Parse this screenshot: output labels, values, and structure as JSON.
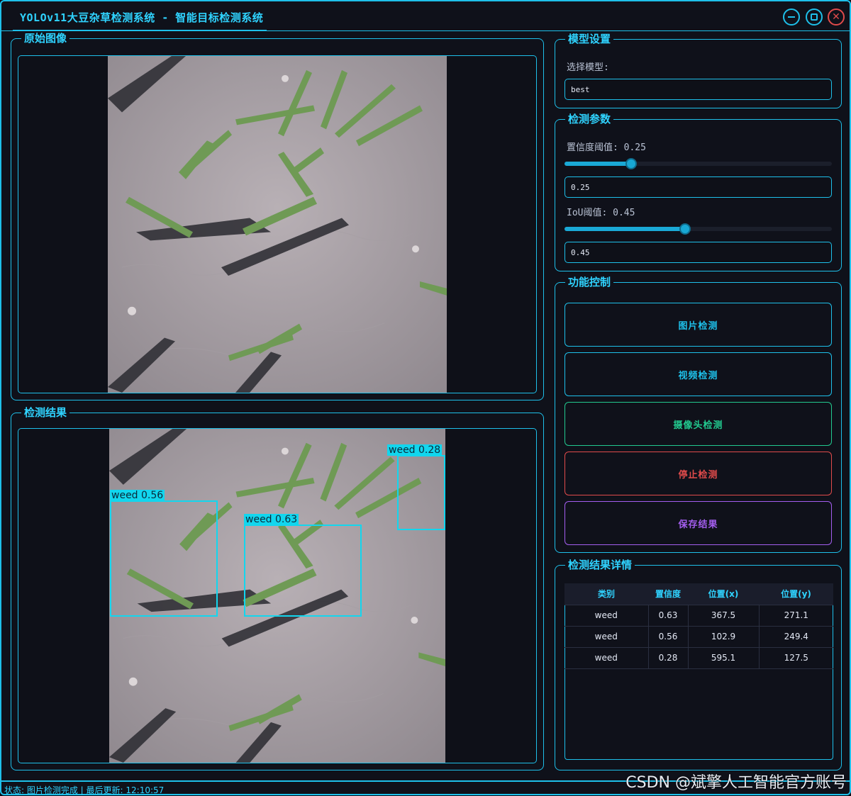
{
  "window": {
    "title": "YOLOv11大豆杂草检测系统 - 智能目标检测系统",
    "accent": "#1ec0ea",
    "close_color": "#e14b4b"
  },
  "original_panel": {
    "title": "原始图像"
  },
  "result_panel": {
    "title": "检测结果",
    "detections": [
      {
        "label": "weed 0.63"
      },
      {
        "label": "weed 0.56"
      },
      {
        "label": "weed 0.28"
      }
    ]
  },
  "model_settings": {
    "title": "模型设置",
    "select_label": "选择模型:",
    "selected_model": "best"
  },
  "detect_params": {
    "title": "检测参数",
    "confidence_label": "置信度阈值: 0.25",
    "confidence_value": "0.25",
    "confidence_level": 0.25,
    "iou_label": "IoU阈值: 0.45",
    "iou_value": "0.45",
    "iou_level": 0.45
  },
  "function_control": {
    "title": "功能控制",
    "buttons": [
      {
        "label": "图片检测",
        "color": "#1ec0ea"
      },
      {
        "label": "视频检测",
        "color": "#1ec0ea"
      },
      {
        "label": "摄像头检测",
        "color": "#22c98f"
      },
      {
        "label": "停止检测",
        "color": "#e14b4b"
      },
      {
        "label": "保存结果",
        "color": "#a45ef0"
      }
    ]
  },
  "result_details": {
    "title": "检测结果详情",
    "headers": [
      "类别",
      "置信度",
      "位置(x)",
      "位置(y)"
    ],
    "rows": [
      [
        "weed",
        "0.63",
        "367.5",
        "271.1"
      ],
      [
        "weed",
        "0.56",
        "102.9",
        "249.4"
      ],
      [
        "weed",
        "0.28",
        "595.1",
        "127.5"
      ]
    ]
  },
  "status": {
    "text": "状态: 图片检测完成 | 最后更新: 12:10:57"
  },
  "watermark": "CSDN @斌擎人工智能官方账号"
}
